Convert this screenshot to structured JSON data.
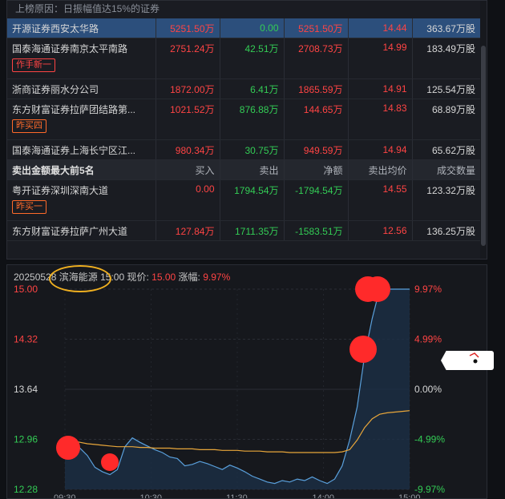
{
  "list": {
    "reason": "上榜原因：日振幅值达15%的证券",
    "buy_rows": [
      {
        "name": "开源证券西安太华路",
        "buy": "5251.50万",
        "sell": "0.00",
        "net": "5251.50万",
        "price": "14.44",
        "volume": "363.67万股",
        "tag": ""
      },
      {
        "name": "国泰海通证券南京太平南路",
        "buy": "2751.24万",
        "sell": "42.51万",
        "net": "2708.73万",
        "price": "14.99",
        "volume": "183.49万股",
        "tag": "作手新一"
      },
      {
        "name": "浙商证券丽水分公司",
        "buy": "1872.00万",
        "sell": "6.41万",
        "net": "1865.59万",
        "price": "14.91",
        "volume": "125.54万股",
        "tag": ""
      },
      {
        "name": "东方财富证券拉萨团结路第...",
        "buy": "1021.52万",
        "sell": "876.88万",
        "net": "144.65万",
        "price": "14.83",
        "volume": "68.89万股",
        "tag": "昨买四"
      },
      {
        "name": "国泰海通证券上海长宁区江...",
        "buy": "980.34万",
        "sell": "30.75万",
        "net": "949.59万",
        "price": "14.94",
        "volume": "65.62万股",
        "tag": ""
      }
    ],
    "sell_header": {
      "title": "卖出金额最大前5名",
      "buy": "买入",
      "sell": "卖出",
      "net": "净额",
      "price": "卖出均价",
      "volume": "成交数量"
    },
    "sell_rows": [
      {
        "name": "粤开证券深圳深南大道",
        "buy": "0.00",
        "sell": "1794.54万",
        "net": "-1794.54万",
        "price": "14.55",
        "volume": "123.32万股",
        "tag": "昨买一"
      },
      {
        "name": "东方财富证券拉萨广州大道",
        "buy": "127.84万",
        "sell": "1711.35万",
        "net": "-1583.51万",
        "price": "12.56",
        "volume": "136.25万股",
        "tag": ""
      }
    ]
  },
  "chart_header": {
    "date": "20250528",
    "name": "滨海能源",
    "time": "15:00",
    "price_label": "现价:",
    "price": "15.00",
    "change_label": "涨幅:",
    "change": "9.97%"
  },
  "chart_data": {
    "type": "line",
    "left_ticks": [
      "15.00",
      "14.32",
      "13.64",
      "12.96",
      "12.28"
    ],
    "right_ticks": [
      "9.97%",
      "4.99%",
      "0.00%",
      "-4.99%",
      "-9.97%"
    ],
    "x_ticks": [
      "09:30",
      "10:30",
      "11:30",
      "14:00",
      "15:00"
    ],
    "ylim": [
      12.28,
      15.0
    ],
    "series": [
      {
        "values": [
          12.95,
          12.9,
          12.84,
          12.74,
          12.58,
          12.52,
          12.48,
          12.55,
          12.86,
          12.98,
          12.92,
          12.87,
          12.82,
          12.78,
          12.72,
          12.7,
          12.6,
          12.62,
          12.66,
          12.63,
          12.59,
          12.55,
          12.61,
          12.57,
          12.52,
          12.46,
          12.42,
          12.38,
          12.36,
          12.4,
          12.38,
          12.42,
          12.4,
          12.45,
          12.4,
          12.36,
          12.42,
          12.6,
          12.95,
          13.4,
          14.1,
          14.6,
          15.0,
          15.0,
          15.0,
          15.0,
          15.0
        ]
      },
      {
        "values": [
          12.96,
          12.94,
          12.92,
          12.9,
          12.89,
          12.88,
          12.87,
          12.86,
          12.86,
          12.86,
          12.85,
          12.85,
          12.84,
          12.84,
          12.84,
          12.83,
          12.83,
          12.83,
          12.82,
          12.82,
          12.82,
          12.81,
          12.81,
          12.81,
          12.8,
          12.8,
          12.8,
          12.79,
          12.79,
          12.79,
          12.78,
          12.78,
          12.78,
          12.78,
          12.78,
          12.78,
          12.78,
          12.79,
          12.82,
          12.95,
          13.12,
          13.24,
          13.3,
          13.32,
          13.33,
          13.34,
          13.35
        ]
      }
    ]
  },
  "colors": {
    "up": "#ff4444",
    "down": "#33cc55",
    "price_line": "#5aa0dc",
    "avg_line": "#e8a63a",
    "highlight": "#ff2a2a"
  }
}
